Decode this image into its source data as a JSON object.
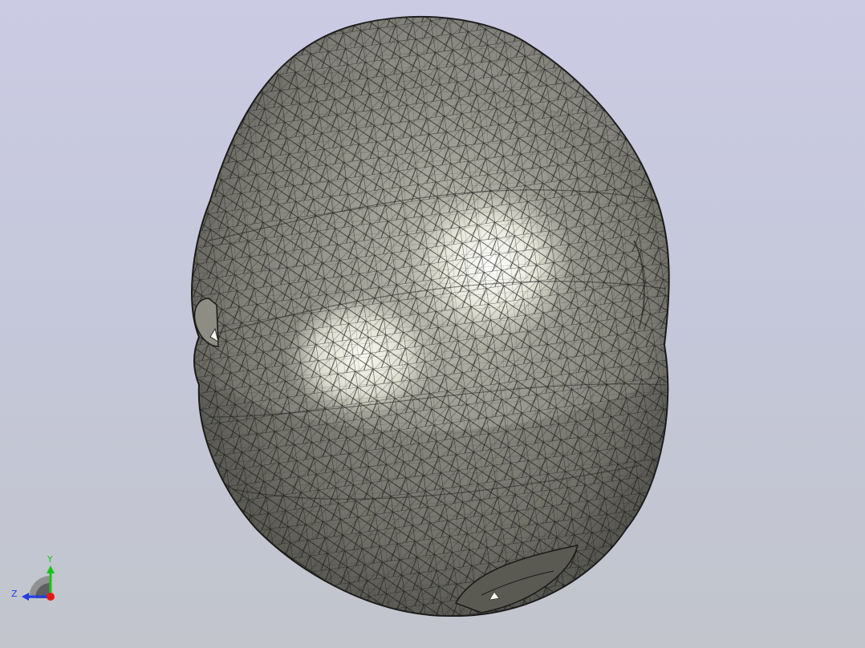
{
  "viewport": {
    "background_top": "#cbcbe4",
    "background_bottom": "#c2c5cc",
    "model": {
      "shading": "shaded-with-edges",
      "surface_color": "#8a8a80",
      "edge_color": "#1a1a1a",
      "highlight_color": "#fbfbf2"
    }
  },
  "triad": {
    "y_label": "Y",
    "z_label": "Z",
    "y_color": "#19c419",
    "z_color": "#1f3fe6",
    "x_color": "#e61919"
  }
}
